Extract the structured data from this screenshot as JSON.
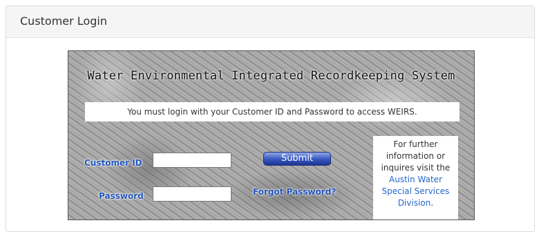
{
  "panel": {
    "title": "Customer Login"
  },
  "login": {
    "system_title": "Water Environmental Integrated Recordkeeping System",
    "notice": "You must login with your Customer ID and Password to access WEIRS.",
    "customer_id_label": "Customer ID",
    "customer_id_value": "",
    "password_label": "Password",
    "password_value": "",
    "submit_label": "Submit",
    "forgot_label": "Forgot Password?"
  },
  "info": {
    "text": "For further information or inquires visit the",
    "link": "Austin Water Special Services Division",
    "suffix": "."
  },
  "colors": {
    "link": "#2255bb",
    "button": "#3556c0"
  }
}
